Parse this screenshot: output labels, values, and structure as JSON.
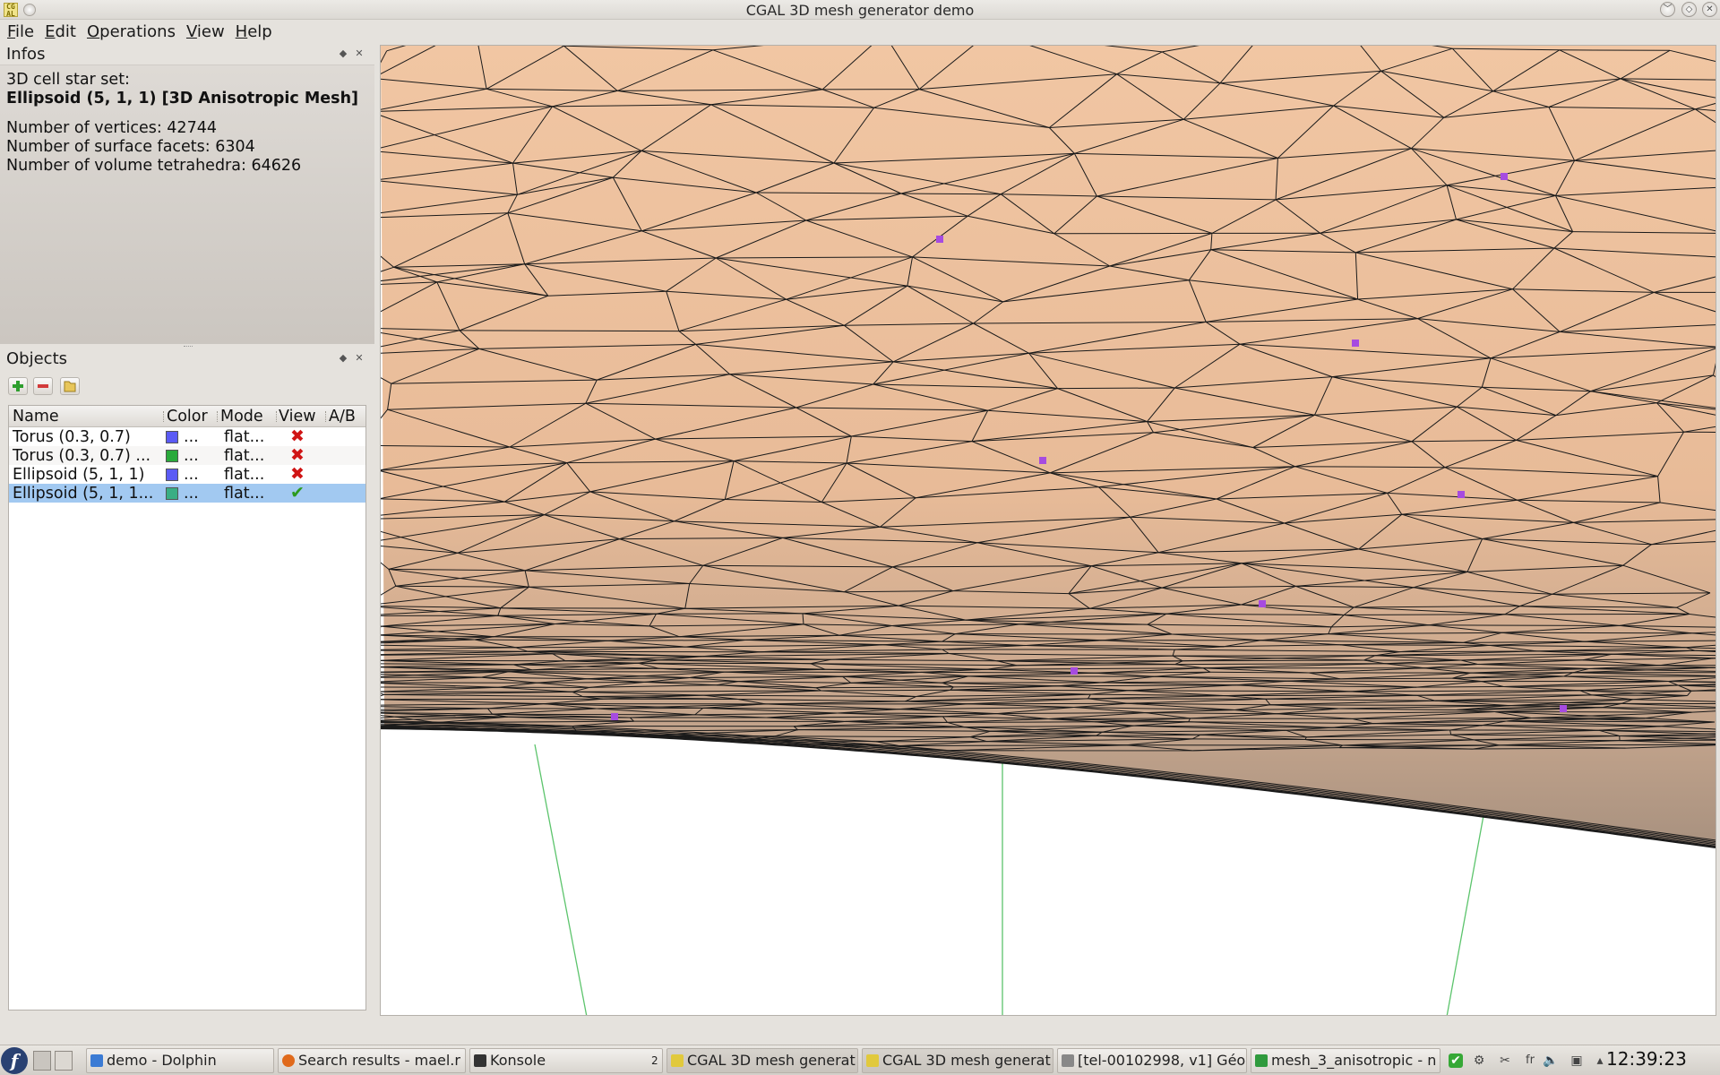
{
  "window": {
    "title": "CGAL 3D mesh generator demo",
    "app_icon_text": "CG AL",
    "buttons": {
      "minimize": "﹀",
      "maximize": "◇",
      "close": "✕"
    }
  },
  "menubar": {
    "items": [
      {
        "label": "File",
        "mnemonic": "F",
        "rest": "ile"
      },
      {
        "label": "Edit",
        "mnemonic": "E",
        "rest": "dit"
      },
      {
        "label": "Operations",
        "mnemonic": "O",
        "rest": "perations"
      },
      {
        "label": "View",
        "mnemonic": "V",
        "rest": "iew"
      },
      {
        "label": "Help",
        "mnemonic": "H",
        "rest": "elp"
      }
    ]
  },
  "infos_panel": {
    "title": "Infos",
    "float_icon": "◆",
    "close_icon": "✕",
    "line1": "3D cell star set:",
    "line2": "Ellipsoid (5, 1, 1) [3D Anisotropic Mesh]",
    "vertices": "Number of vertices: 42744",
    "facets": "Number of surface facets: 6304",
    "tetrahedra": "Number of volume tetrahedra: 64626"
  },
  "objects_panel": {
    "title": "Objects",
    "float_icon": "◆",
    "close_icon": "✕",
    "toolbar": {
      "add": "add-icon",
      "remove": "remove-icon",
      "load": "folder-icon"
    },
    "columns": [
      "Name",
      "Color",
      "Mode",
      "View",
      "A/B"
    ],
    "rows": [
      {
        "name": "Torus (0.3, 0.7)",
        "color": "#5b5bf5",
        "color_text": "...",
        "mode": "flat...",
        "view": "✖",
        "view_color": "#d01515",
        "visible": false
      },
      {
        "name": "Torus (0.3, 0.7) ...",
        "color": "#2aaa3c",
        "color_text": "...",
        "mode": "flat...",
        "view": "✖",
        "view_color": "#d01515",
        "visible": false
      },
      {
        "name": "Ellipsoid (5, 1, 1)",
        "color": "#5b5bf5",
        "color_text": "...",
        "mode": "flat...",
        "view": "✖",
        "view_color": "#d01515",
        "visible": false
      },
      {
        "name": "Ellipsoid (5, 1, 1...",
        "color": "#3aae84",
        "color_text": "...",
        "mode": "flat...",
        "view": "✔",
        "view_color": "#2c9a1e",
        "visible": true,
        "selected": true
      }
    ]
  },
  "viewer": {
    "surface_color_top": "#f1c6a3",
    "surface_color_bottom": "#b29a86",
    "edge_color": "#1a1a1a",
    "marker_color": "#a64be0",
    "axis_color": "#5cc46c"
  },
  "taskbar": {
    "tasks": [
      {
        "label": "demo - Dolphin",
        "icon_color": "#3b7bd4"
      },
      {
        "label": "Search results - mael.r",
        "icon_color": "#e06a1b"
      },
      {
        "label": "Konsole",
        "icon_color": "#333333"
      },
      {
        "label": "CGAL 3D mesh generat",
        "icon_color": "#e1c93c"
      },
      {
        "label": "CGAL 3D mesh generat",
        "icon_color": "#e1c93c"
      },
      {
        "label": "[tel-00102998, v1] Géo",
        "icon_color": "#888888"
      },
      {
        "label": "mesh_3_anisotropic - n",
        "icon_color": "#2f9a3d"
      }
    ],
    "konsole_badge": "2",
    "tray": [
      "✔",
      "⚙",
      "✂",
      "fr",
      "🔈",
      "▣",
      "▴"
    ],
    "clock": "12:39:23"
  }
}
